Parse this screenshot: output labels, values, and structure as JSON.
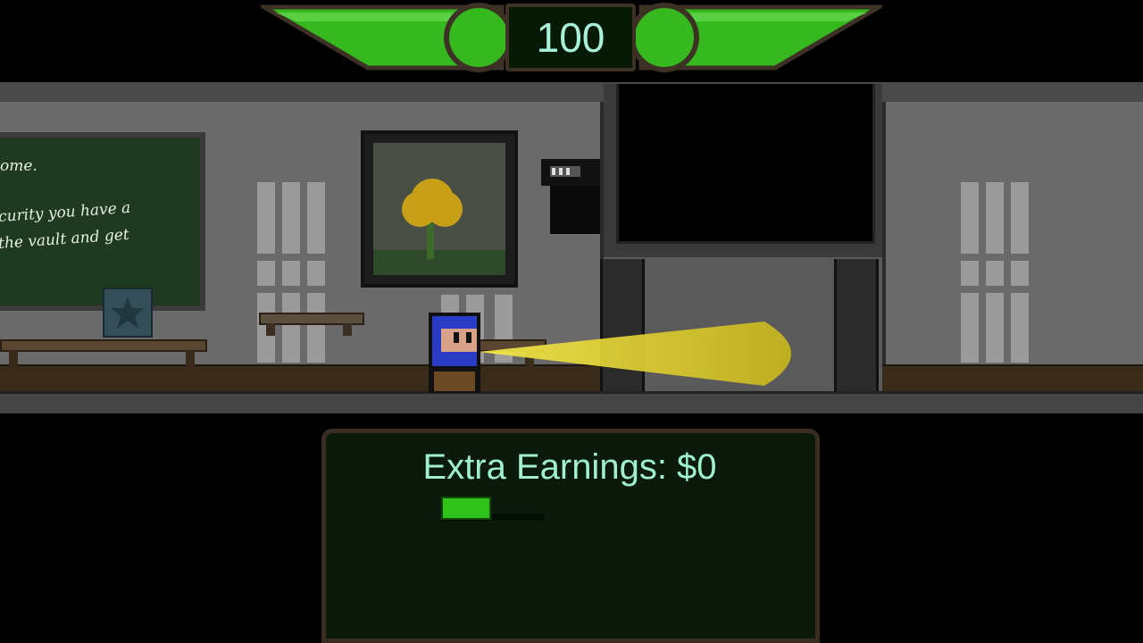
{
  "hud": {
    "score": "100",
    "health_fraction": 1.0,
    "bar_color": "#36b81f"
  },
  "scene": {
    "chalkboard_lines": [
      "ome.",
      "curity you have a",
      "the vault and get"
    ],
    "player_icon": "guard-player-icon",
    "enemy_icon": "security-camera-icon",
    "flashlight_color": "#d9cc2a"
  },
  "panel": {
    "earnings_label": "Extra Earnings: $0",
    "progress_fraction": 0.48
  }
}
